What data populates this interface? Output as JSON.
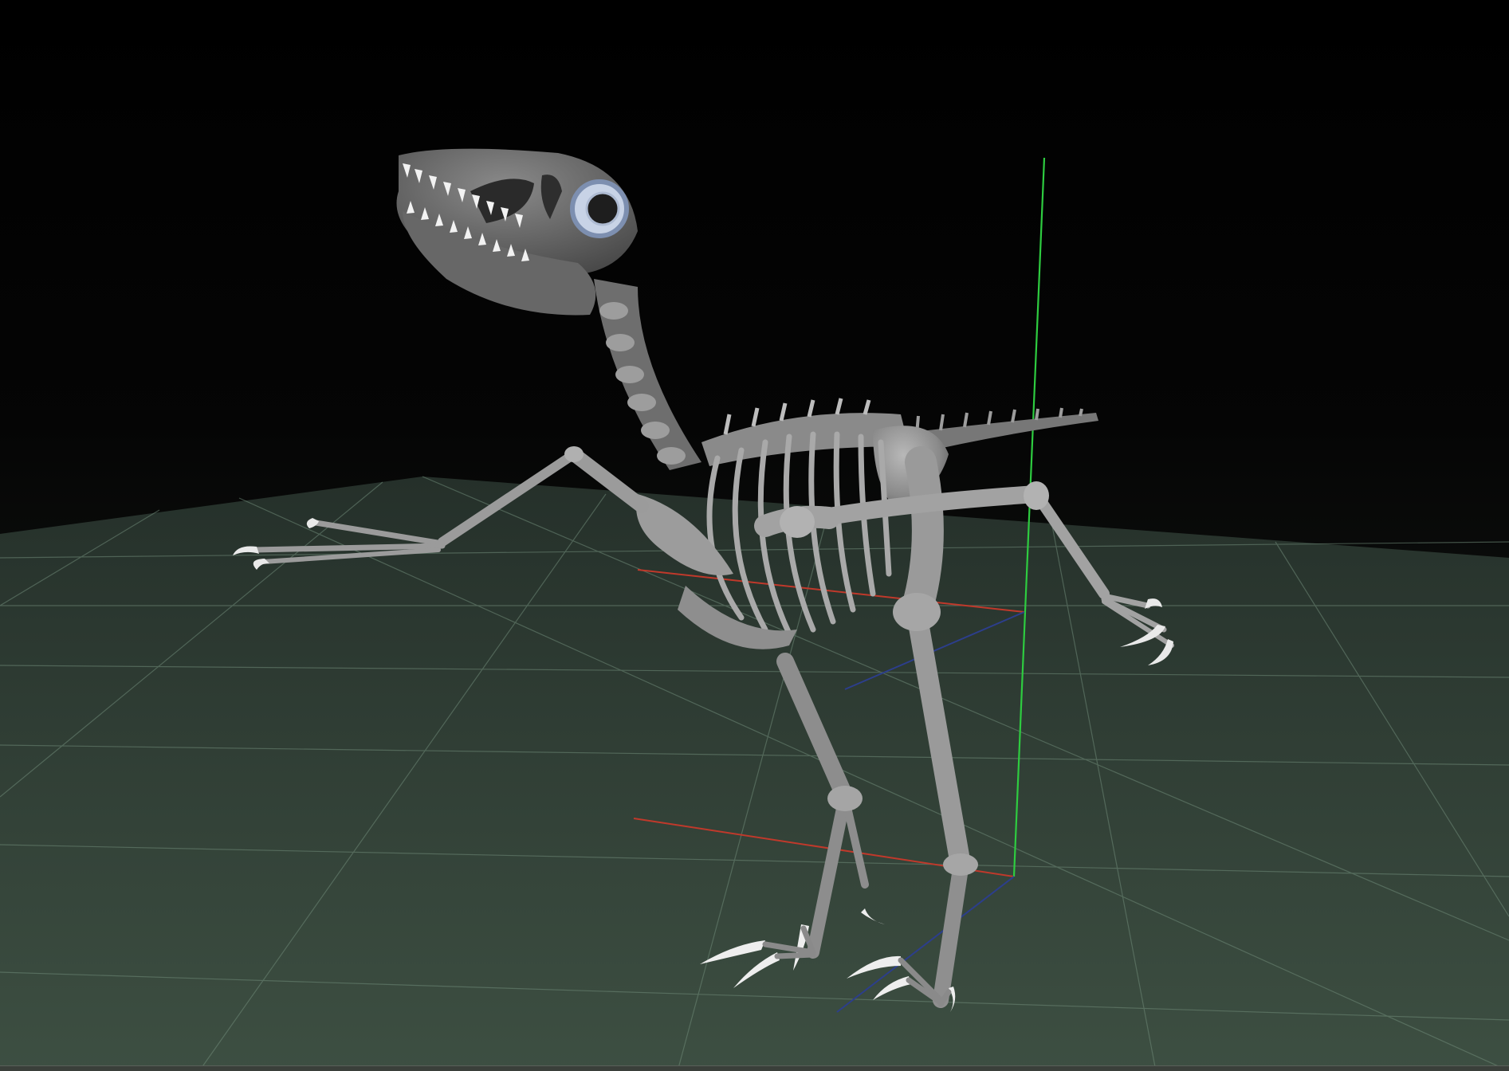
{
  "viewport": {
    "background_top": "#000000",
    "background_bottom": "#1c241e",
    "floor_color": "#3a4a3f",
    "grid_color": "#6f8a78",
    "bone_color": "#9a9a9a",
    "bone_dark": "#5e5e5e",
    "claw_color": "#e8e8e8",
    "eye_ring_color": "#9fb2d2"
  },
  "gizmo": {
    "x_axis_color": "#c0392b",
    "y_axis_color": "#2ecc40",
    "z_axis_color": "#2c3e8c"
  }
}
